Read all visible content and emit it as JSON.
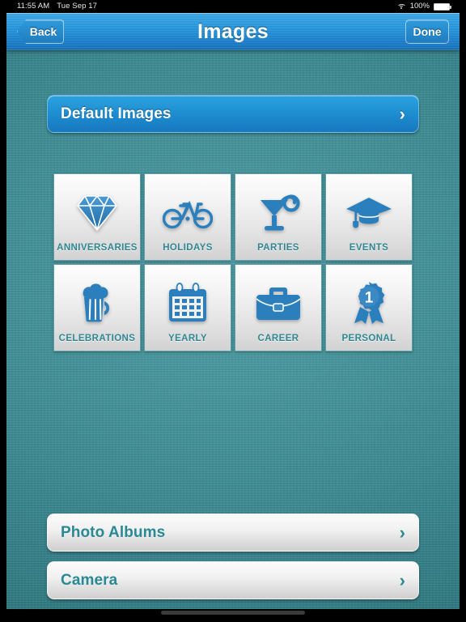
{
  "status_bar": {
    "time": "11:55 AM",
    "date": "Tue Sep 17",
    "wifi_icon": "wifi-icon",
    "battery_percent": "100%",
    "battery_icon": "battery-full-icon"
  },
  "nav_bar": {
    "back_label": "Back",
    "title": "Images",
    "done_label": "Done"
  },
  "main": {
    "default_images": {
      "label": "Default Images",
      "chevron": "›",
      "icon": "chevron-right-icon"
    },
    "categories": [
      {
        "label": "ANNIVERSARIES",
        "icon": "diamond-icon"
      },
      {
        "label": "HOLIDAYS",
        "icon": "bicycle-icon"
      },
      {
        "label": "PARTIES",
        "icon": "cocktail-glass-icon"
      },
      {
        "label": "EVENTS",
        "icon": "graduation-cap-icon"
      },
      {
        "label": "CELEBRATIONS",
        "icon": "beer-mug-icon"
      },
      {
        "label": "YEARLY",
        "icon": "calendar-icon"
      },
      {
        "label": "CAREER",
        "icon": "briefcase-icon"
      },
      {
        "label": "PERSONAL",
        "icon": "award-ribbon-icon"
      }
    ],
    "award_ribbon_number": "1",
    "photo_albums": {
      "label": "Photo Albums",
      "chevron": "›",
      "icon": "chevron-right-icon"
    },
    "camera": {
      "label": "Camera",
      "chevron": "›",
      "icon": "chevron-right-icon"
    }
  },
  "colors": {
    "nav_blue": "#1f8fd2",
    "background_teal": "#3d8b93",
    "accent_teal_text": "#2f8791",
    "icon_blue": "#2b7fbd",
    "tile_face": "#f1f1f1"
  }
}
